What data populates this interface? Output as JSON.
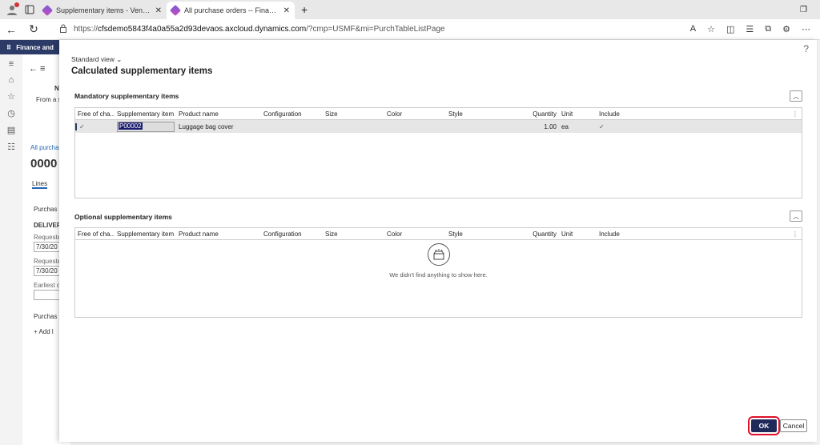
{
  "browser": {
    "tabs": [
      {
        "title": "Supplementary items - Vendor"
      },
      {
        "title": "All purchase orders -- Finance and"
      }
    ],
    "url_prefix": "https://",
    "url_host": "cfsdemo5843f4a0a55a2d93devaos.axcloud.dynamics.com",
    "url_path": "/?cmp=USMF&mi=PurchTableListPage"
  },
  "app": {
    "title": "Finance and",
    "background": {
      "header_n": "N",
      "from_text": "From a s",
      "breadcrumb": "All purcha",
      "record_id": "0000",
      "tab_lines": "Lines",
      "section_purchase": "Purchas",
      "delivery_label": "DELIVERY",
      "requested_label_1": "Requeste",
      "date_1": "7/30/20",
      "requested_label_2": "Requeste",
      "date_2": "7/30/20",
      "earliest_label": "Earliest c",
      "section_purchase_2": "Purchas",
      "add_line": "+ Add l"
    }
  },
  "dialog": {
    "help": "?",
    "view_selector": "Standard view",
    "title": "Calculated supplementary items",
    "mandatory": {
      "title": "Mandatory supplementary items",
      "columns": [
        "Free of cha...",
        "Supplementary item",
        "Product name",
        "Configuration",
        "Size",
        "Color",
        "Style",
        "Quantity",
        "Unit",
        "Include"
      ],
      "rows": [
        {
          "free_of_charge": "✓",
          "item": "P00002",
          "product_name": "Luggage bag cover",
          "configuration": "",
          "size": "",
          "color": "",
          "style": "",
          "quantity": "1.00",
          "unit": "ea",
          "include": "✓"
        }
      ]
    },
    "optional": {
      "title": "Optional supplementary items",
      "columns": [
        "Free of cha...",
        "Supplementary item",
        "Product name",
        "Configuration",
        "Size",
        "Color",
        "Style",
        "Quantity",
        "Unit",
        "Include"
      ],
      "empty_text": "We didn't find anything to show here."
    },
    "ok_label": "OK",
    "cancel_label": "Cancel"
  }
}
